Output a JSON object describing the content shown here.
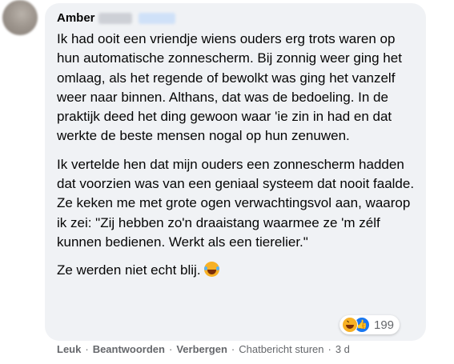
{
  "comment": {
    "author": "Amber",
    "paragraphs": [
      "Ik had ooit een vriendje wiens ouders erg trots waren op hun automatische zonnescherm. Bij zonnig weer ging het omlaag, als het regende of bewolkt was ging het vanzelf weer naar binnen. Althans, dat was de bedoeling. In de praktijk deed het ding gewoon waar 'ie zin in had en dat werkte de beste mensen nogal op hun zenuwen.",
      "Ik vertelde hen dat mijn ouders een zonnescherm hadden dat voorzien was van een geniaal systeem dat nooit faalde. Ze keken me met grote ogen verwachtingsvol aan, waarop ik zei: \"Zij hebben zo'n draaistang waarmee ze 'm zélf kunnen bedienen. Werkt als een tierelier.\"",
      "Ze werden niet echt blij."
    ],
    "last_emoji": "grinning-squinting-face-with-tears",
    "reactions": {
      "icons": [
        "haha-reaction-icon",
        "like-reaction-icon"
      ],
      "count": "199",
      "colors": {
        "haha": "#f7b125",
        "like": "#1877f2"
      }
    }
  },
  "actions": {
    "like": "Leuk",
    "reply": "Beantwoorden",
    "hide": "Verbergen",
    "message": "Chatbericht sturen",
    "time": "3 d",
    "separator": "·"
  },
  "colors": {
    "bubble": "#f0f2f5",
    "text": "#050505",
    "secondary": "#65676b"
  }
}
